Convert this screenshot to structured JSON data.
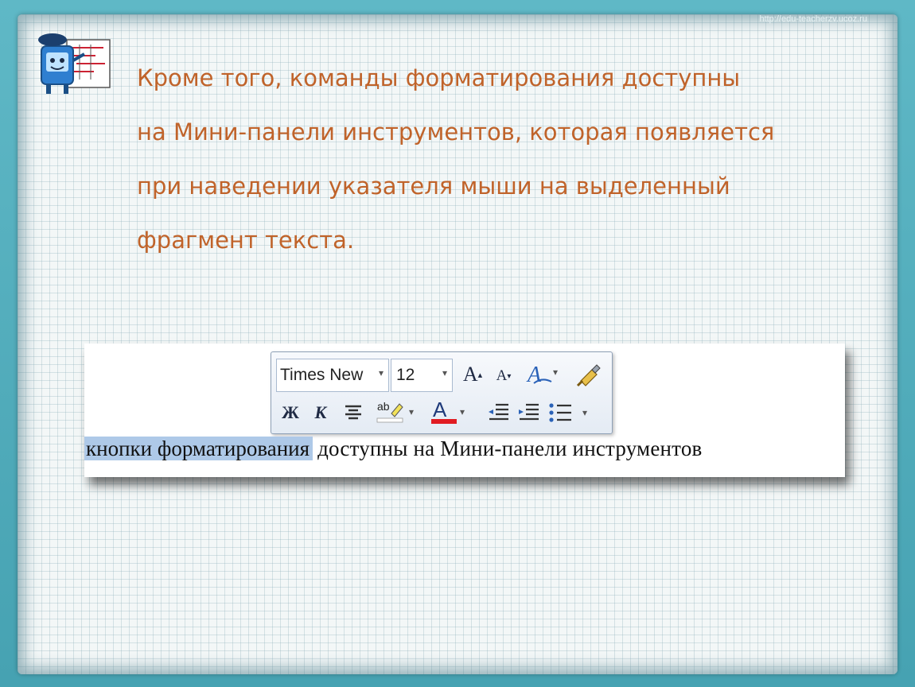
{
  "slide": {
    "url": "http://edu-teacherzv.ucoz.ru",
    "lines": [
      "Кроме того, команды форматирования доступны",
      "на Мини-панели инструментов, которая появляется",
      "при наведении указателя мыши на выделенный",
      "фрагмент текста."
    ],
    "text_color": "#c0632a"
  },
  "mini_toolbar": {
    "font_name": "Times New",
    "font_size": "12",
    "bold_label": "Ж",
    "italic_label": "К",
    "highlight_label": "ab",
    "font_color_label": "A",
    "font_color": "#e11b22",
    "icons": [
      "grow-font-icon",
      "shrink-font-icon",
      "styles-icon",
      "format-painter-icon",
      "bold-icon",
      "italic-icon",
      "center-align-icon",
      "highlight-icon",
      "font-color-icon",
      "decrease-indent-icon",
      "increase-indent-icon",
      "bullets-icon"
    ]
  },
  "document": {
    "selected_text": "кнопки форматирования",
    "rest_text": "доступны на Мини-панели инструментов",
    "selection_color": "#aec9e8"
  }
}
